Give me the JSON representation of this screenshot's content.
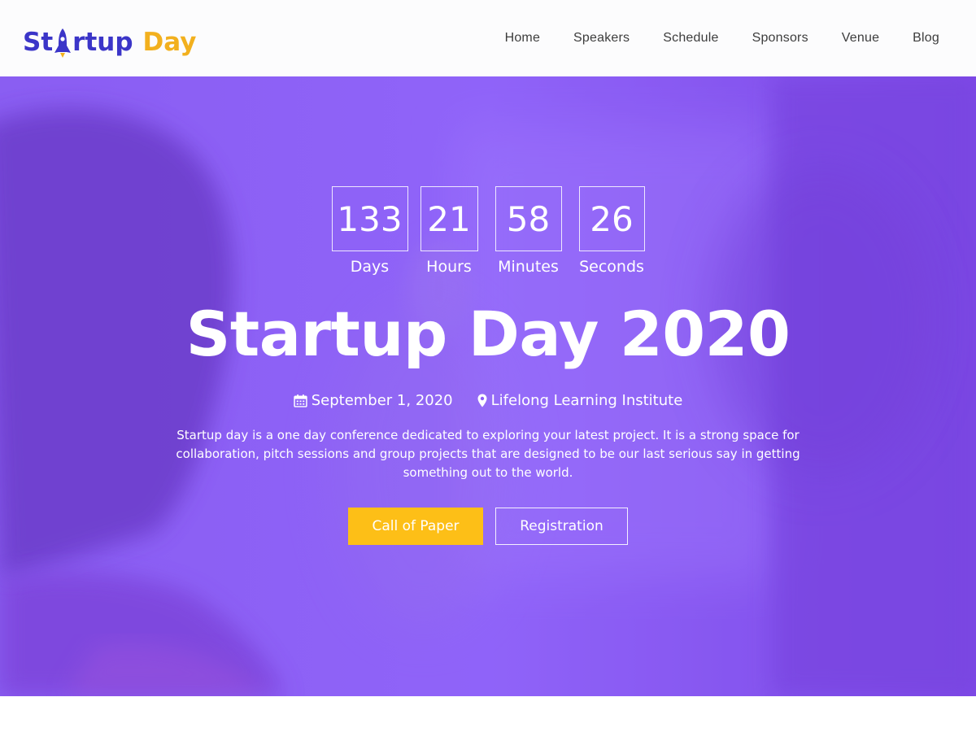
{
  "brand": {
    "logo_part1_start": "St",
    "logo_part1_end": "rtup",
    "logo_part2": "Day",
    "primary_color": "#3b35c8",
    "accent_color": "#f2b01e"
  },
  "nav": {
    "items": [
      {
        "label": "Home"
      },
      {
        "label": "Speakers"
      },
      {
        "label": "Schedule"
      },
      {
        "label": "Sponsors"
      },
      {
        "label": "Venue"
      },
      {
        "label": "Blog"
      }
    ]
  },
  "hero": {
    "overlay_color": "#8a5cf7",
    "countdown": [
      {
        "value": "133",
        "label": "Days"
      },
      {
        "value": "21",
        "label": "Hours"
      },
      {
        "value": "58",
        "label": "Minutes"
      },
      {
        "value": "26",
        "label": "Seconds"
      }
    ],
    "title": "Startup Day 2020",
    "date": "September 1, 2020",
    "date_icon": "calendar-icon",
    "location": "Lifelong Learning Institute",
    "location_icon": "map-marker-icon",
    "description": "Startup day is a one day conference dedicated to exploring your latest project. It is a strong space for collaboration, pitch sessions and group projects that are designed to be our last serious say in getting something out to the world.",
    "primary_button": "Call of Paper",
    "primary_button_color": "#fdbf17",
    "secondary_button": "Registration"
  }
}
